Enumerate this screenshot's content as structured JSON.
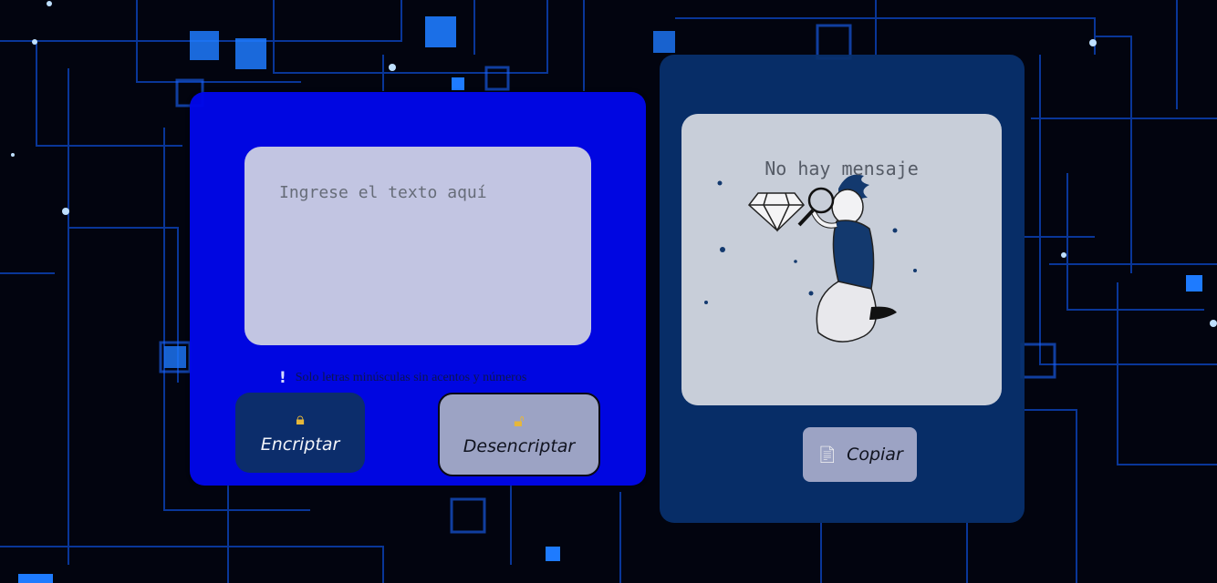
{
  "encrypt_panel": {
    "input_placeholder": "Ingrese el texto aquí",
    "hint_icon": "!",
    "hint_text": "Solo letras minúsculas sin acentos y números",
    "encrypt_button": {
      "icon": "lock-icon",
      "label": "Encriptar"
    },
    "decrypt_button": {
      "icon": "unlock-icon",
      "label": "Desencriptar"
    }
  },
  "output_panel": {
    "empty_message": "No hay mensaje",
    "illustration": "person-with-magnifying-glass-and-diamond",
    "copy_button": {
      "icon": "document-icon",
      "label": "Copiar"
    }
  },
  "colors": {
    "left_panel": "#0006e8",
    "right_panel": "#08306e",
    "encrypt_button": "#0c2d6b",
    "secondary_button": "#9ca3c4",
    "text_area": "#d7dae2"
  }
}
